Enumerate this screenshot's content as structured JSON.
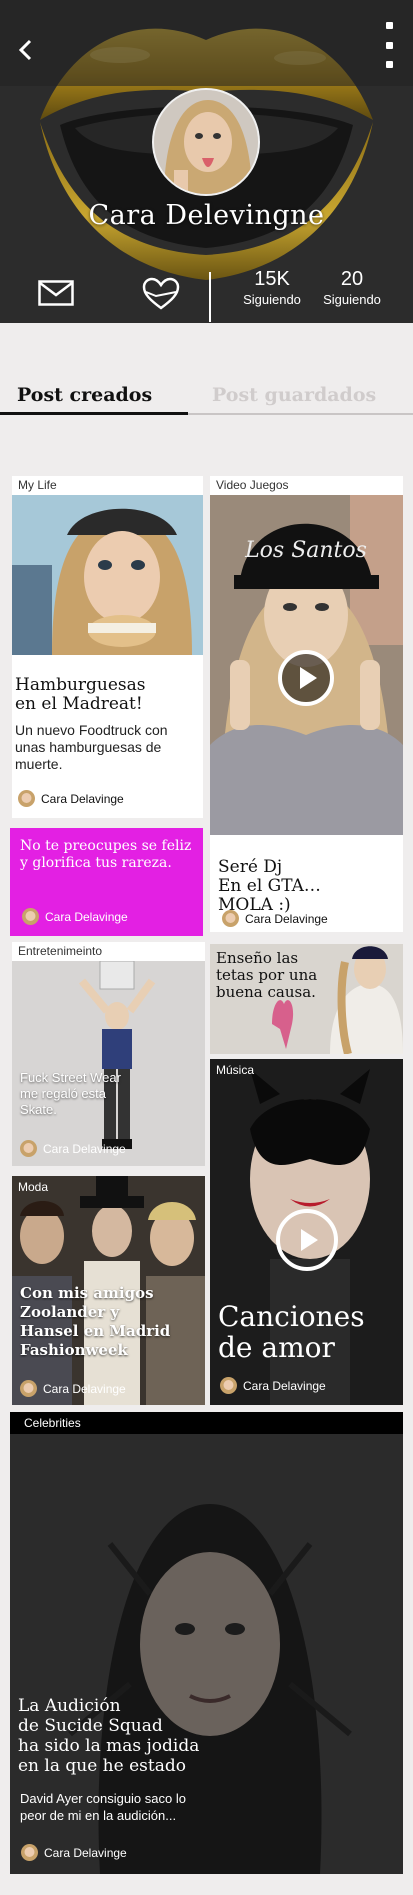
{
  "profile": {
    "name": "Cara Delevingne",
    "stats": [
      {
        "value": "15K",
        "label": "Siguiendo"
      },
      {
        "value": "20",
        "label": "Siguiendo"
      }
    ]
  },
  "tabs": [
    {
      "label": "Post creados",
      "active": true
    },
    {
      "label": "Post guardados",
      "active": false
    }
  ],
  "posts": [
    {
      "category": "My Life",
      "title_lines": [
        "Hamburguesas",
        "en el Madreat!"
      ],
      "description": "Un nuevo Foodtruck con unas hamburguesas de muerte.",
      "author": "Cara Delavinge"
    },
    {
      "category": "Video Juegos",
      "title_lines": [
        "Seré Dj",
        "En el GTA…",
        "MOLA :)"
      ],
      "author": "Cara Delavinge",
      "has_video": true
    },
    {
      "category": "",
      "text": "No te preocupes se feliz y glorifica tus rareza.",
      "author": "Cara Delavinge",
      "background": "#e320e3"
    },
    {
      "category": "Entretenimeinto",
      "text": "Fuck Street Wear me regaló esta Skate.",
      "author": "Cara Delavinge"
    },
    {
      "category": "",
      "text": "Enseño las tetas por una buena causa."
    },
    {
      "category": "Música",
      "title_lines": [
        "Canciones",
        "de amor"
      ],
      "author": "Cara Delavinge",
      "has_video": true
    },
    {
      "category": "Moda",
      "title_lines": [
        "Con mis amigos",
        "Zoolander y",
        "Hansel en Madrid",
        "Fashionweek"
      ],
      "author": "Cara Delavinge"
    },
    {
      "category": "Celebrities",
      "title_lines": [
        "La Audición",
        "de Sucide Squad",
        "ha sido la mas jodida",
        "en la que he estado"
      ],
      "description": "David Ayer consiguio saco lo peor de mi en la audición...",
      "author": "Cara Delavinge"
    }
  ],
  "colors": {
    "header_bg": "#2a2a2a",
    "lips_gold": "#c9a227",
    "accent_magenta": "#e320e3",
    "page_bg": "#efeded"
  },
  "icons": [
    "back-arrow-icon",
    "more-vertical-icon",
    "mail-icon",
    "heart-hands-icon",
    "play-icon"
  ]
}
